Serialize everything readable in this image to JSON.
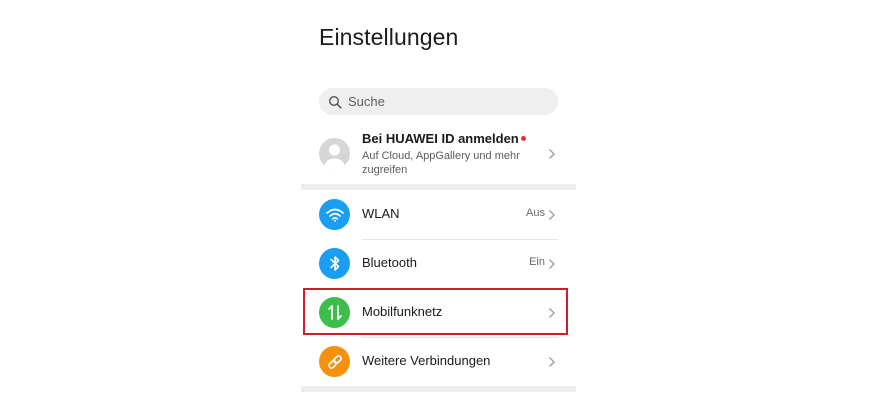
{
  "page": {
    "title": "Einstellungen"
  },
  "search": {
    "placeholder": "Suche"
  },
  "account": {
    "title": "Bei HUAWEI ID anmelden",
    "subtitle": "Auf Cloud, AppGallery und mehr zugreifen"
  },
  "settings": [
    {
      "label": "WLAN",
      "value": "Aus",
      "icon": "wifi-icon",
      "color": "#1a9ef5"
    },
    {
      "label": "Bluetooth",
      "value": "Ein",
      "icon": "bluetooth-icon",
      "color": "#1a9ef5"
    },
    {
      "label": "Mobilfunknetz",
      "value": "",
      "icon": "mobile-data-icon",
      "color": "#3bbf4a"
    },
    {
      "label": "Weitere Verbindungen",
      "value": "",
      "icon": "link-icon",
      "color": "#f7900f"
    }
  ],
  "colors": {
    "highlight": "#d01f2a",
    "notification_dot": "#e8322f"
  }
}
